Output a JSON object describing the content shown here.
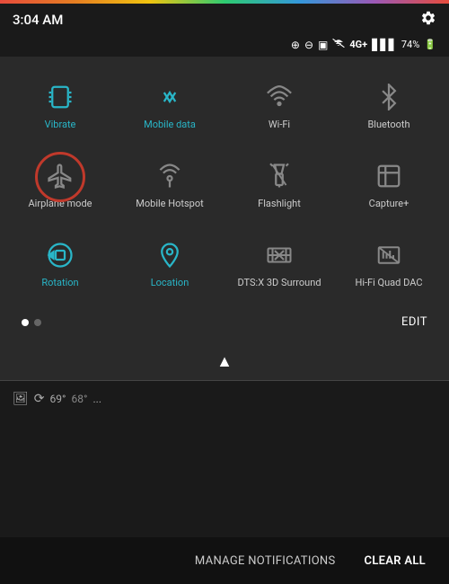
{
  "statusBar": {
    "time": "3:04 AM",
    "battery": "74%",
    "signal": "4G",
    "gearLabel": "Settings"
  },
  "quickSettings": {
    "editLabel": "EDIT",
    "tiles": [
      {
        "id": "vibrate",
        "label": "Vibrate",
        "icon": "vibrate",
        "active": true,
        "highlighted": false
      },
      {
        "id": "mobile-data",
        "label": "Mobile data",
        "icon": "mobile-data",
        "active": true,
        "highlighted": false
      },
      {
        "id": "wifi",
        "label": "Wi-Fi",
        "icon": "wifi",
        "active": false,
        "highlighted": false
      },
      {
        "id": "bluetooth",
        "label": "Bluetooth",
        "icon": "bluetooth",
        "active": false,
        "highlighted": false
      },
      {
        "id": "airplane",
        "label": "Airplane mode",
        "icon": "airplane",
        "active": false,
        "highlighted": true
      },
      {
        "id": "mobile-hotspot",
        "label": "Mobile Hotspot",
        "icon": "hotspot",
        "active": false,
        "highlighted": false
      },
      {
        "id": "flashlight",
        "label": "Flashlight",
        "icon": "flashlight",
        "active": false,
        "highlighted": false
      },
      {
        "id": "capture-plus",
        "label": "Capture+",
        "icon": "capture",
        "active": false,
        "highlighted": false
      },
      {
        "id": "rotation",
        "label": "Rotation",
        "icon": "rotation",
        "active": true,
        "highlighted": false
      },
      {
        "id": "location",
        "label": "Location",
        "icon": "location",
        "active": true,
        "highlighted": false
      },
      {
        "id": "dts",
        "label": "DTS:X 3D Surround",
        "icon": "dts",
        "active": false,
        "highlighted": false
      },
      {
        "id": "hifi",
        "label": "Hi-Fi Quad DAC",
        "icon": "hifi",
        "active": false,
        "highlighted": false
      }
    ]
  },
  "pageIndicators": {
    "current": 0,
    "total": 2
  },
  "bottomBar": {
    "manageNotifications": "MANAGE NOTIFICATIONS",
    "clearAll": "CLEAR ALL"
  },
  "notificationBar": {
    "temp": "69°",
    "tempLow": "68°",
    "dotsLabel": "..."
  }
}
